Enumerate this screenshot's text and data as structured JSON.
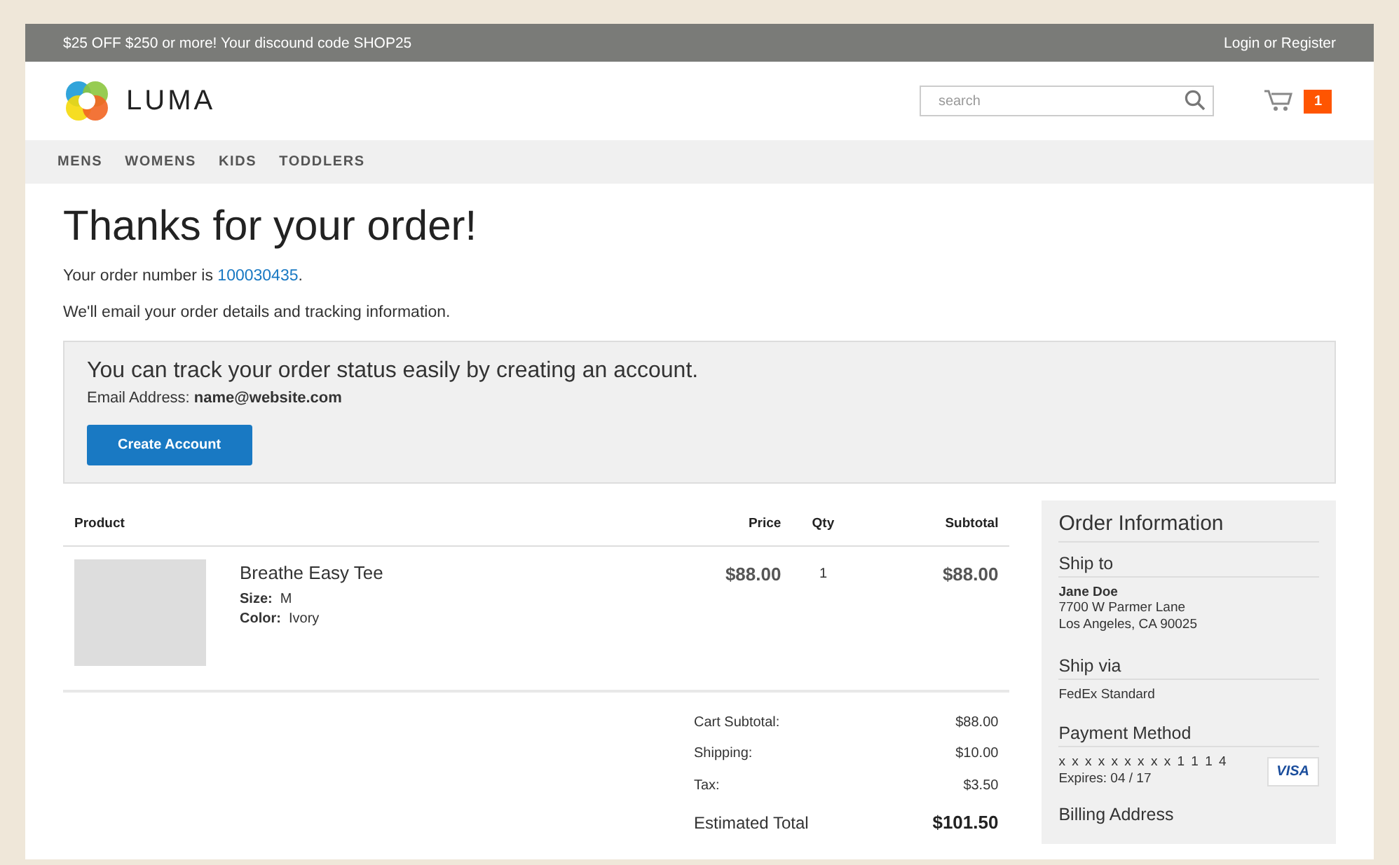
{
  "promo_bar": {
    "message": "$25 OFF $250 or more! Your discound code SHOP25",
    "account_link": "Login or Register"
  },
  "header": {
    "logo_text": "LUMA",
    "search": {
      "placeholder": "search"
    },
    "cart_count": "1"
  },
  "nav": {
    "items": [
      "MENS",
      "WOMENS",
      "KIDS",
      "TODDLERS"
    ]
  },
  "page_title": "Thanks for your order!",
  "order_number": {
    "prefix": "Your order number is ",
    "number": "100030435",
    "suffix": "."
  },
  "email_notice": "We'll email your order details and tracking information.",
  "account_box": {
    "heading": "You can track your order status easily by creating an account.",
    "email": "Email Address: **name@website.com**",
    "button": "Create Account"
  },
  "table": {
    "columns": [
      "Product",
      "Price",
      "Qty",
      "Subtotal"
    ],
    "rows": [
      {
        "name": "Breathe Easy Tee",
        "options": [
          {
            "label": "Size:",
            "value": "M"
          },
          {
            "label": "Color:",
            "value": "Ivory"
          }
        ],
        "price": "$88.00",
        "qty": "1",
        "subtotal": "$88.00"
      }
    ]
  },
  "totals": [
    {
      "label": "Cart Subtotal:",
      "value": "$88.00",
      "kind": "line"
    },
    {
      "label": "Shipping:",
      "value": "$10.00",
      "kind": "line"
    },
    {
      "label": "Tax:",
      "value": "$3.50",
      "kind": "line"
    },
    {
      "label": "Estimated Total",
      "value": "$101.50",
      "kind": "grand"
    }
  ],
  "order_information": {
    "title": "Order Information",
    "ship_to": {
      "heading": "Ship to",
      "name": "Jane Doe",
      "lines": [
        "7700 W Parmer Lane",
        "Los Angeles, CA 90025"
      ]
    },
    "ship_via": {
      "heading": "Ship via",
      "method": "FedEx Standard"
    },
    "payment": {
      "heading": "Payment Method",
      "card_number": "x x x x x x x x x 1 1 1 4",
      "expires": "Expires: 04 / 17",
      "card_brand": "VISA"
    },
    "billing": {
      "heading": "Billing Address"
    }
  }
}
